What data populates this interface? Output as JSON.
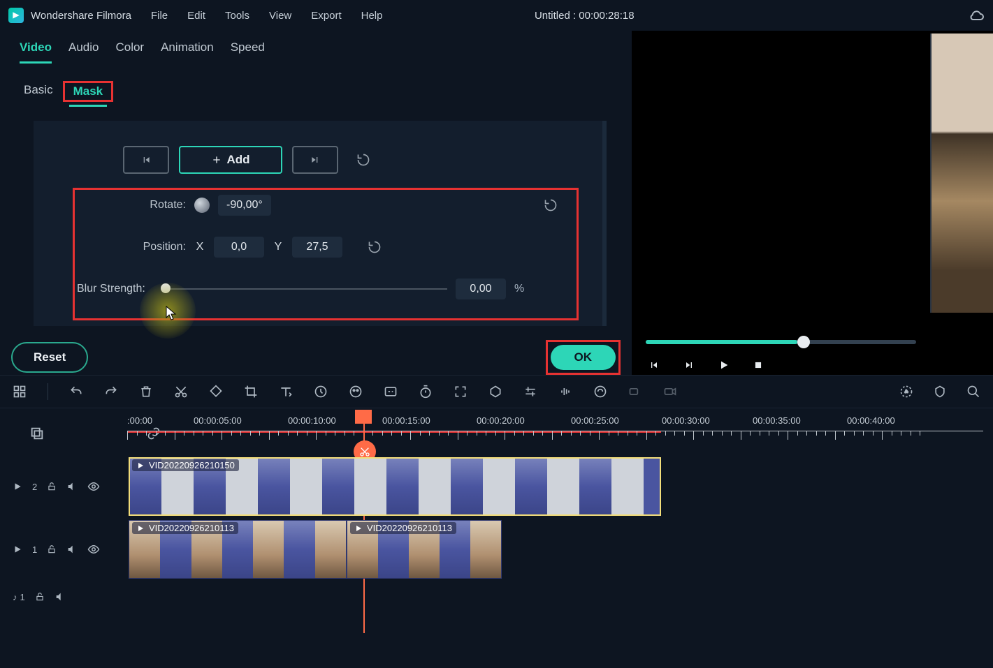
{
  "app": {
    "name": "Wondershare Filmora",
    "document": "Untitled : 00:00:28:18"
  },
  "menu": [
    "File",
    "Edit",
    "Tools",
    "View",
    "Export",
    "Help"
  ],
  "tabs_primary": [
    "Video",
    "Audio",
    "Color",
    "Animation",
    "Speed"
  ],
  "tabs_secondary": {
    "basic": "Basic",
    "mask": "Mask"
  },
  "props": {
    "add_label": "Add",
    "rotate_label": "Rotate:",
    "rotate_value": "-90,00°",
    "position_label": "Position:",
    "x_label": "X",
    "x_value": "0,0",
    "y_label": "Y",
    "y_value": "27,5",
    "blur_label": "Blur Strength:",
    "blur_value": "0,00",
    "blur_unit": "%"
  },
  "buttons": {
    "reset": "Reset",
    "ok": "OK"
  },
  "timeline": {
    "labels": [
      ":00:00",
      "00:00:05:00",
      "00:00:10:00",
      "00:00:15:00",
      "00:00:20:00",
      "00:00:25:00",
      "00:00:30:00",
      "00:00:35:00",
      "00:00:40:00"
    ],
    "track1": {
      "index": "2",
      "clip": "VID20220926210150"
    },
    "track2": {
      "index": "1",
      "clipA": "VID20220926210113",
      "clipB": "VID20220926210113"
    },
    "audio": {
      "index": "1"
    }
  }
}
